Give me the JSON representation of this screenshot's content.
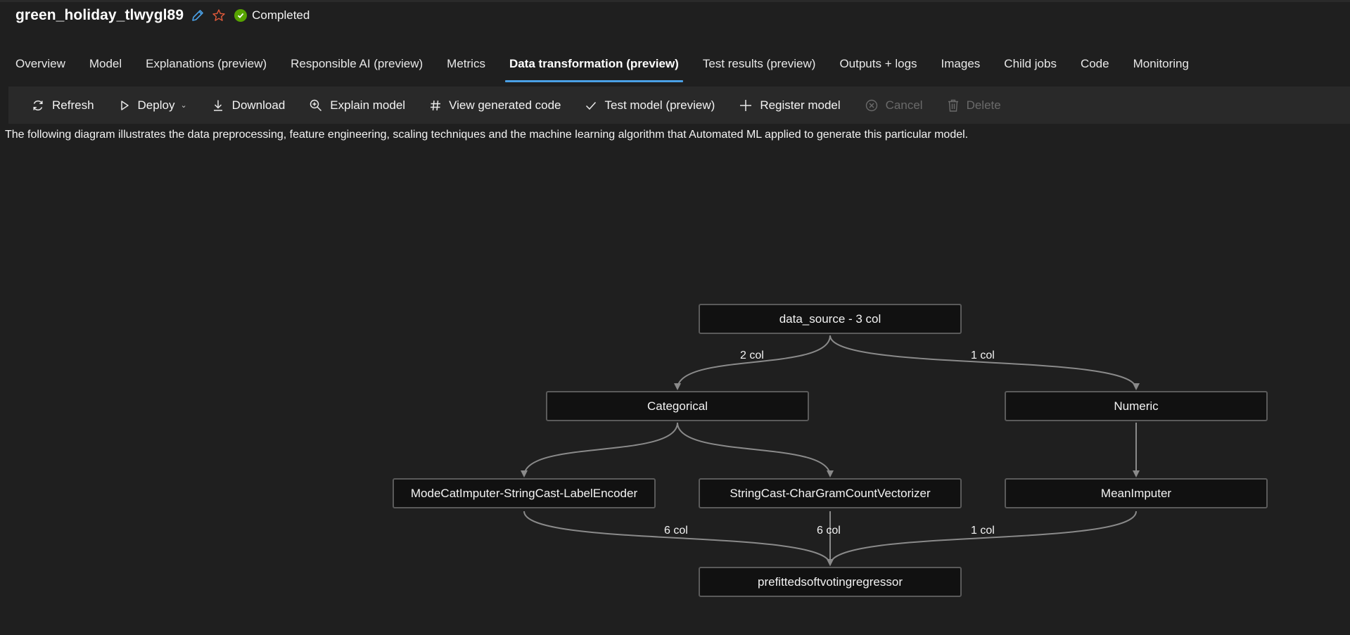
{
  "header": {
    "job_name": "green_holiday_tlwygl89",
    "status": "Completed",
    "icons": {
      "edit": "pencil-icon",
      "favorite": "star-icon",
      "status": "check-circle-icon"
    },
    "colors": {
      "status": "#57a300",
      "accent": "#4aa0e6",
      "star": "#e05a3a"
    }
  },
  "tabs": [
    {
      "label": "Overview"
    },
    {
      "label": "Model"
    },
    {
      "label": "Explanations (preview)"
    },
    {
      "label": "Responsible AI (preview)"
    },
    {
      "label": "Metrics"
    },
    {
      "label": "Data transformation (preview)",
      "active": true
    },
    {
      "label": "Test results (preview)"
    },
    {
      "label": "Outputs + logs"
    },
    {
      "label": "Images"
    },
    {
      "label": "Child jobs"
    },
    {
      "label": "Code"
    },
    {
      "label": "Monitoring"
    }
  ],
  "toolbar": {
    "refresh": {
      "label": "Refresh",
      "icon": "refresh-icon"
    },
    "deploy": {
      "label": "Deploy",
      "icon": "play-icon"
    },
    "download": {
      "label": "Download",
      "icon": "download-icon"
    },
    "explain": {
      "label": "Explain model",
      "icon": "zoom-in-icon"
    },
    "code": {
      "label": "View generated code",
      "icon": "hash-icon"
    },
    "test": {
      "label": "Test model (preview)",
      "icon": "checkmark-icon"
    },
    "register": {
      "label": "Register model",
      "icon": "plus-icon"
    },
    "cancel": {
      "label": "Cancel",
      "icon": "cancel-circle-icon",
      "disabled": true
    },
    "delete": {
      "label": "Delete",
      "icon": "trash-icon",
      "disabled": true
    }
  },
  "description": "The following diagram illustrates the data preprocessing, feature engineering, scaling techniques and the machine learning algorithm that Automated ML applied to generate this particular model.",
  "diagram": {
    "nodes": {
      "source": "data_source - 3 col",
      "categorical": "Categorical",
      "numeric": "Numeric",
      "mode_imputer": "ModeCatImputer-StringCast-LabelEncoder",
      "chargram": "StringCast-CharGramCountVectorizer",
      "mean_imputer": "MeanImputer",
      "model": "prefittedsoftvotingregressor"
    },
    "edge_labels": {
      "source_to_categorical": "2 col",
      "source_to_numeric": "1 col",
      "mode_to_model": "6 col",
      "chargram_to_model": "6 col",
      "mean_to_model": "1 col"
    }
  }
}
